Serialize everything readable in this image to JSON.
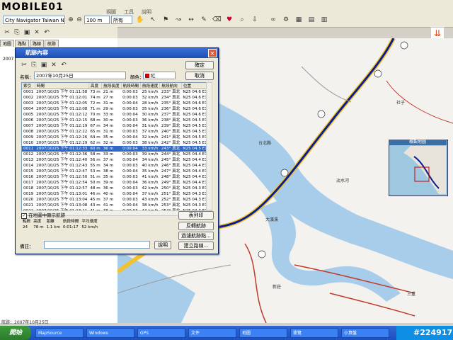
{
  "app": {
    "logo": "MOBILE01",
    "menu": [
      "視圖",
      "工具",
      "說明"
    ],
    "map_combo": "City Navigator Taiwan NT v.8",
    "zoom_combo": "100 m",
    "mode_combo": "所有"
  },
  "sidebar": {
    "tabs": [
      "地圖",
      "路點",
      "路線",
      "航跡"
    ],
    "item": "2007"
  },
  "dialog": {
    "title": "航跡內容",
    "ok_label": "確定",
    "cancel_label": "取消",
    "name_label": "名稱：",
    "name_value": "2007年10月25日",
    "color_label": "顏色：",
    "color_value": "紅",
    "columns": [
      "索引",
      "時間",
      "高度",
      "航段長度",
      "航段時間",
      "航段速度",
      "航段航向",
      "位置"
    ],
    "rows": [
      [
        "0001",
        "2007/10/25 下午 01:11:58",
        "73 m",
        "21 m",
        "0:00:03",
        "25 km/h",
        "233° 真北",
        "N25 04.6 E121 27.1"
      ],
      [
        "0002",
        "2007/10/25 下午 01:12:01",
        "74 m",
        "27 m",
        "0:00:03",
        "32 km/h",
        "234° 真北",
        "N25 04.6 E121 27.1"
      ],
      [
        "0003",
        "2007/10/25 下午 01:12:05",
        "72 m",
        "31 m",
        "0:00:04",
        "28 km/h",
        "235° 真北",
        "N25 04.6 E121 27.1"
      ],
      [
        "0004",
        "2007/10/25 下午 01:12:08",
        "71 m",
        "29 m",
        "0:00:03",
        "35 km/h",
        "236° 真北",
        "N25 04.6 E121 27.0"
      ],
      [
        "0005",
        "2007/10/25 下午 01:12:12",
        "70 m",
        "33 m",
        "0:00:04",
        "30 km/h",
        "237° 真北",
        "N25 04.6 E121 27.0"
      ],
      [
        "0006",
        "2007/10/25 下午 01:12:15",
        "68 m",
        "30 m",
        "0:00:03",
        "36 km/h",
        "238° 真北",
        "N25 04.5 E121 27.0"
      ],
      [
        "0007",
        "2007/10/25 下午 01:12:19",
        "67 m",
        "34 m",
        "0:00:04",
        "31 km/h",
        "239° 真北",
        "N25 04.5 E121 27.0"
      ],
      [
        "0008",
        "2007/10/25 下午 01:12:22",
        "65 m",
        "31 m",
        "0:00:03",
        "37 km/h",
        "240° 真北",
        "N25 04.5 E121 26.9"
      ],
      [
        "0009",
        "2007/10/25 下午 01:12:26",
        "64 m",
        "35 m",
        "0:00:04",
        "32 km/h",
        "241° 真北",
        "N25 04.5 E121 26.9"
      ],
      [
        "0010",
        "2007/10/25 下午 01:12:29",
        "62 m",
        "32 m",
        "0:00:03",
        "38 km/h",
        "242° 真北",
        "N25 04.5 E121 26.9"
      ],
      [
        "0011",
        "2007/10/25 下午 01:12:33",
        "60 m",
        "36 m",
        "0:00:04",
        "33 km/h",
        "243° 真北",
        "N25 04.5 E121 26.9"
      ],
      [
        "0012",
        "2007/10/25 下午 01:12:36",
        "58 m",
        "33 m",
        "0:00:03",
        "39 km/h",
        "244° 真北",
        "N25 04.4 E121 26.8"
      ],
      [
        "0013",
        "2007/10/25 下午 01:12:40",
        "56 m",
        "37 m",
        "0:00:04",
        "34 km/h",
        "245° 真北",
        "N25 04.4 E121 26.8"
      ],
      [
        "0014",
        "2007/10/25 下午 01:12:43",
        "55 m",
        "34 m",
        "0:00:03",
        "40 km/h",
        "246° 真北",
        "N25 04.4 E121 26.8"
      ],
      [
        "0015",
        "2007/10/25 下午 01:12:47",
        "53 m",
        "38 m",
        "0:00:04",
        "35 km/h",
        "247° 真北",
        "N25 04.4 E121 26.8"
      ],
      [
        "0016",
        "2007/10/25 下午 01:12:50",
        "51 m",
        "35 m",
        "0:00:03",
        "41 km/h",
        "248° 真北",
        "N25 04.4 E121 26.7"
      ],
      [
        "0017",
        "2007/10/25 下午 01:12:54",
        "50 m",
        "39 m",
        "0:00:04",
        "36 km/h",
        "249° 真北",
        "N25 04.4 E121 26.7"
      ],
      [
        "0018",
        "2007/10/25 下午 01:12:57",
        "48 m",
        "36 m",
        "0:00:03",
        "42 km/h",
        "250° 真北",
        "N25 04.3 E121 26.7"
      ],
      [
        "0019",
        "2007/10/25 下午 01:13:01",
        "46 m",
        "40 m",
        "0:00:04",
        "37 km/h",
        "251° 真北",
        "N25 04.3 E121 26.7"
      ],
      [
        "0020",
        "2007/10/25 下午 01:13:04",
        "45 m",
        "37 m",
        "0:00:03",
        "43 km/h",
        "252° 真北",
        "N25 04.3 E121 26.6"
      ],
      [
        "0021",
        "2007/10/25 下午 01:13:08",
        "43 m",
        "41 m",
        "0:00:04",
        "38 km/h",
        "253° 真北",
        "N25 04.3 E121 26.6"
      ],
      [
        "0022",
        "2007/10/25 下午 01:13:11",
        "41 m",
        "38 m",
        "0:00:03",
        "44 km/h",
        "254° 真北",
        "N25 04.3 E121 26.6"
      ],
      [
        "0023",
        "2007/10/25 下午 01:13:15",
        "40 m",
        "42 m",
        "0:00:04",
        "39 km/h",
        "255° 真北",
        "N25 04.3 E121 26.6"
      ],
      [
        "0024",
        "2007/10/25 下午 01:13:18",
        "38 m",
        "39 m",
        "0:00:03",
        "45 km/h",
        "256° 真北",
        "N25 04.2 E121 26.5"
      ]
    ],
    "selected_row": 10,
    "show_on_map_label": "在地圖中顯示航跡",
    "stats_headers": [
      "點數",
      "高度",
      "距離",
      "航段時間",
      "平均速度"
    ],
    "stats_values": [
      "24",
      "78 m",
      "1.1 km",
      "0:01:17",
      "52 km/h"
    ],
    "btn_table": "表列印",
    "btn_invert": "反轉航跡",
    "btn_filter": "過濾航跡點...",
    "btn_route": "建立路線...",
    "note_label": "備註：",
    "note_btn": "說明"
  },
  "map": {
    "labels": [
      "台北縣",
      "社子",
      "淡水河",
      "大漢溪",
      "新莊",
      "三重"
    ],
    "inset_title": "概觀地圖"
  },
  "taskbar": {
    "start": "開始",
    "tasks": [
      "MapSource",
      "Windows",
      "GPS",
      "文件",
      "地圖",
      "瀏覽",
      "小算盤"
    ],
    "watermark": "#224917"
  },
  "status": {
    "text": "航跡：2007年10月25日"
  },
  "colors": {
    "water": "#a8cdea",
    "road_highway": "#f2c12e",
    "track": "#0a1f8f",
    "road_red": "#c0392b"
  }
}
